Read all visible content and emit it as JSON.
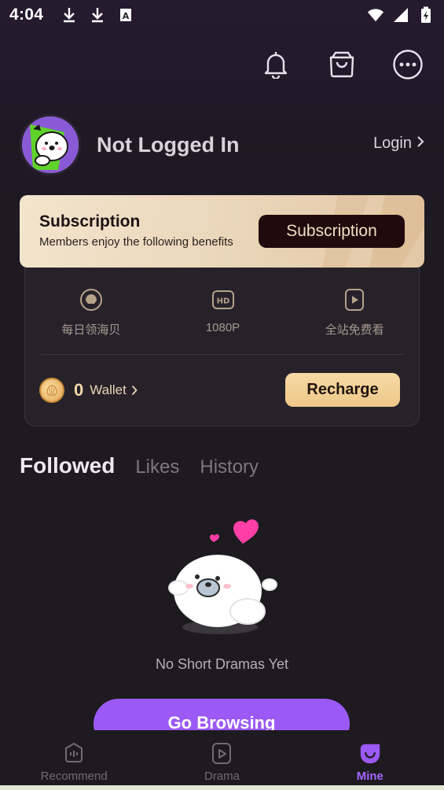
{
  "status_bar": {
    "time": "4:04",
    "left_icons": [
      "download-icon",
      "download-icon",
      "text-a-icon"
    ],
    "right_icons": [
      "wifi-icon",
      "signal-icon",
      "battery-charging-icon"
    ]
  },
  "top_actions": [
    "bell-icon",
    "shopping-bag-icon",
    "more-icon"
  ],
  "profile": {
    "name": "Not Logged In",
    "login_label": "Login"
  },
  "subscription": {
    "title": "Subscription",
    "description": "Members enjoy the following benefits",
    "button_label": "Subscription"
  },
  "benefits": [
    {
      "icon": "shell-icon",
      "label": "每日领海贝"
    },
    {
      "icon": "hd-icon",
      "label": "1080P"
    },
    {
      "icon": "play-icon",
      "label": "全站免费看"
    }
  ],
  "wallet": {
    "count": "0",
    "label": "Wallet",
    "recharge_label": "Recharge"
  },
  "tabs": [
    {
      "label": "Followed",
      "active": true
    },
    {
      "label": "Likes",
      "active": false
    },
    {
      "label": "History",
      "active": false
    }
  ],
  "empty_state": {
    "text": "No Short Dramas Yet",
    "button_label": "Go Browsing"
  },
  "bottom_nav": [
    {
      "label": "Recommend",
      "icon": "recommend-icon",
      "active": false
    },
    {
      "label": "Drama",
      "icon": "drama-icon",
      "active": false
    },
    {
      "label": "Mine",
      "icon": "mine-icon",
      "active": true
    }
  ],
  "colors": {
    "accent": "#9b59f5",
    "gold": "#eec889",
    "background": "#1d1b1f"
  }
}
